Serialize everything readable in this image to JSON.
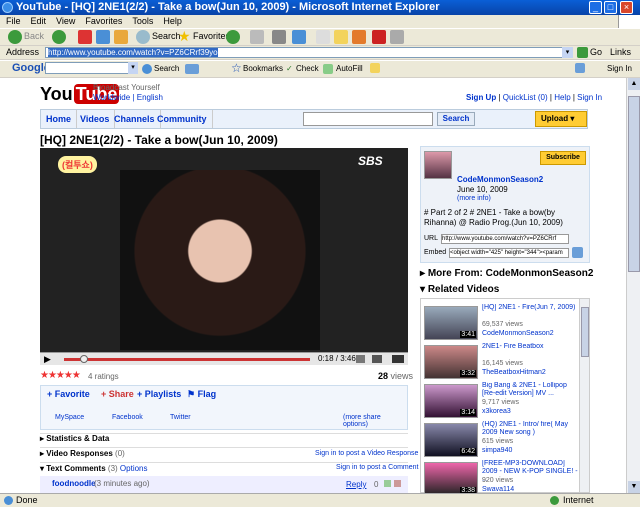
{
  "window": {
    "title": "YouTube - [HQ] 2NE1(2/2) - Take a bow(Jun 10, 2009) - Microsoft Internet Explorer"
  },
  "menu": [
    "File",
    "Edit",
    "View",
    "Favorites",
    "Tools",
    "Help"
  ],
  "toolbar": {
    "back": "Back",
    "search": "Search",
    "favorites": "Favorites"
  },
  "address": {
    "label": "Address",
    "url": "http://www.youtube.com/watch?v=PZ6CRrf39yo",
    "go": "Go",
    "links": "Links"
  },
  "googlebar": {
    "logo": "Google",
    "search": "Search",
    "bookmarks": "Bookmarks",
    "check": "Check",
    "autofill": "AutoFill",
    "signin": "Sign In"
  },
  "yt": {
    "logo_you": "You",
    "logo_tube": "Tube",
    "tagline": "Broadcast Yourself",
    "region": "Worldwide",
    "lang": "English",
    "top_links": [
      "Sign Up",
      "QuickList (0)",
      "Help",
      "Sign In"
    ],
    "nav": [
      "Home",
      "Videos",
      "Channels",
      "Community"
    ],
    "search_button": "Search",
    "upload": "Upload",
    "title": "[HQ] 2NE1(2/2) - Take a bow(Jun 10, 2009)",
    "player": {
      "time": "0:18 / 3:46",
      "logo": "SBS",
      "progress": 0.08,
      "caption": "(컬투쇼)"
    },
    "ratings_text": "4 ratings",
    "stars": 5,
    "views_count": "28",
    "views_label": "views",
    "actions": [
      "Favorite",
      "Share",
      "Playlists",
      "Flag"
    ],
    "share": [
      "MySpace",
      "Facebook",
      "Twitter",
      "(more share options)"
    ],
    "sections": [
      {
        "label": "Statistics & Data",
        "right": ""
      },
      {
        "label": "Video Responses",
        "count": "(0)",
        "right": "Sign in to post a Video Response"
      },
      {
        "label": "Text Comments",
        "count": "(3)",
        "options": "Options",
        "right": "Sign in to post a Comment"
      }
    ],
    "comment": {
      "user": "foodnoodle",
      "time": "(3 minutes ago)",
      "reply": "Reply",
      "score": "0"
    },
    "channel": {
      "name": "CodeMonmonSeason2",
      "date": "June 10, 2009",
      "more": "(more info)",
      "subscribe": "Subscribe",
      "desc": "# Part 2 of 2 # 2NE1 - Take a bow(by Rihanna) @ Radio Prog.(Jun 10, 2009)",
      "url_label": "URL",
      "url": "http://www.youtube.com/watch?v=PZ6CRrf",
      "embed_label": "Embed",
      "embed": "<object width=\"425\" height=\"344\"><param"
    },
    "more_from": "More From: CodeMonmonSeason2",
    "related_title": "Related Videos",
    "related": [
      {
        "title": "[HQ] 2NE1 - Fire(Jun 7, 2009)",
        "views": "69,537 views",
        "user": "CodeMonmonSeason2",
        "dur": "3:41"
      },
      {
        "title": "2NE1- Fire Beatbox",
        "views": "16,145 views",
        "user": "TheBeatboxHitman2",
        "dur": "3:32"
      },
      {
        "title": "Big Bang & 2NE1 - Lollipop [Re-edit Version] MV ...",
        "views": "9,717 views",
        "user": "x3korea3",
        "dur": "3:14"
      },
      {
        "title": "(HQ) 2NE1 - Intro/ fire( May 2009 New song )",
        "views": "615 views",
        "user": "simpa940",
        "dur": "6:42"
      },
      {
        "title": "[FREE-MP3-DOWNLOAD] 2009 - NEW K-POP SINGLE! - ...",
        "views": "920 views",
        "user": "Swava114",
        "dur": "3:38"
      }
    ]
  },
  "status": {
    "left": "Done",
    "zone": "Internet"
  }
}
